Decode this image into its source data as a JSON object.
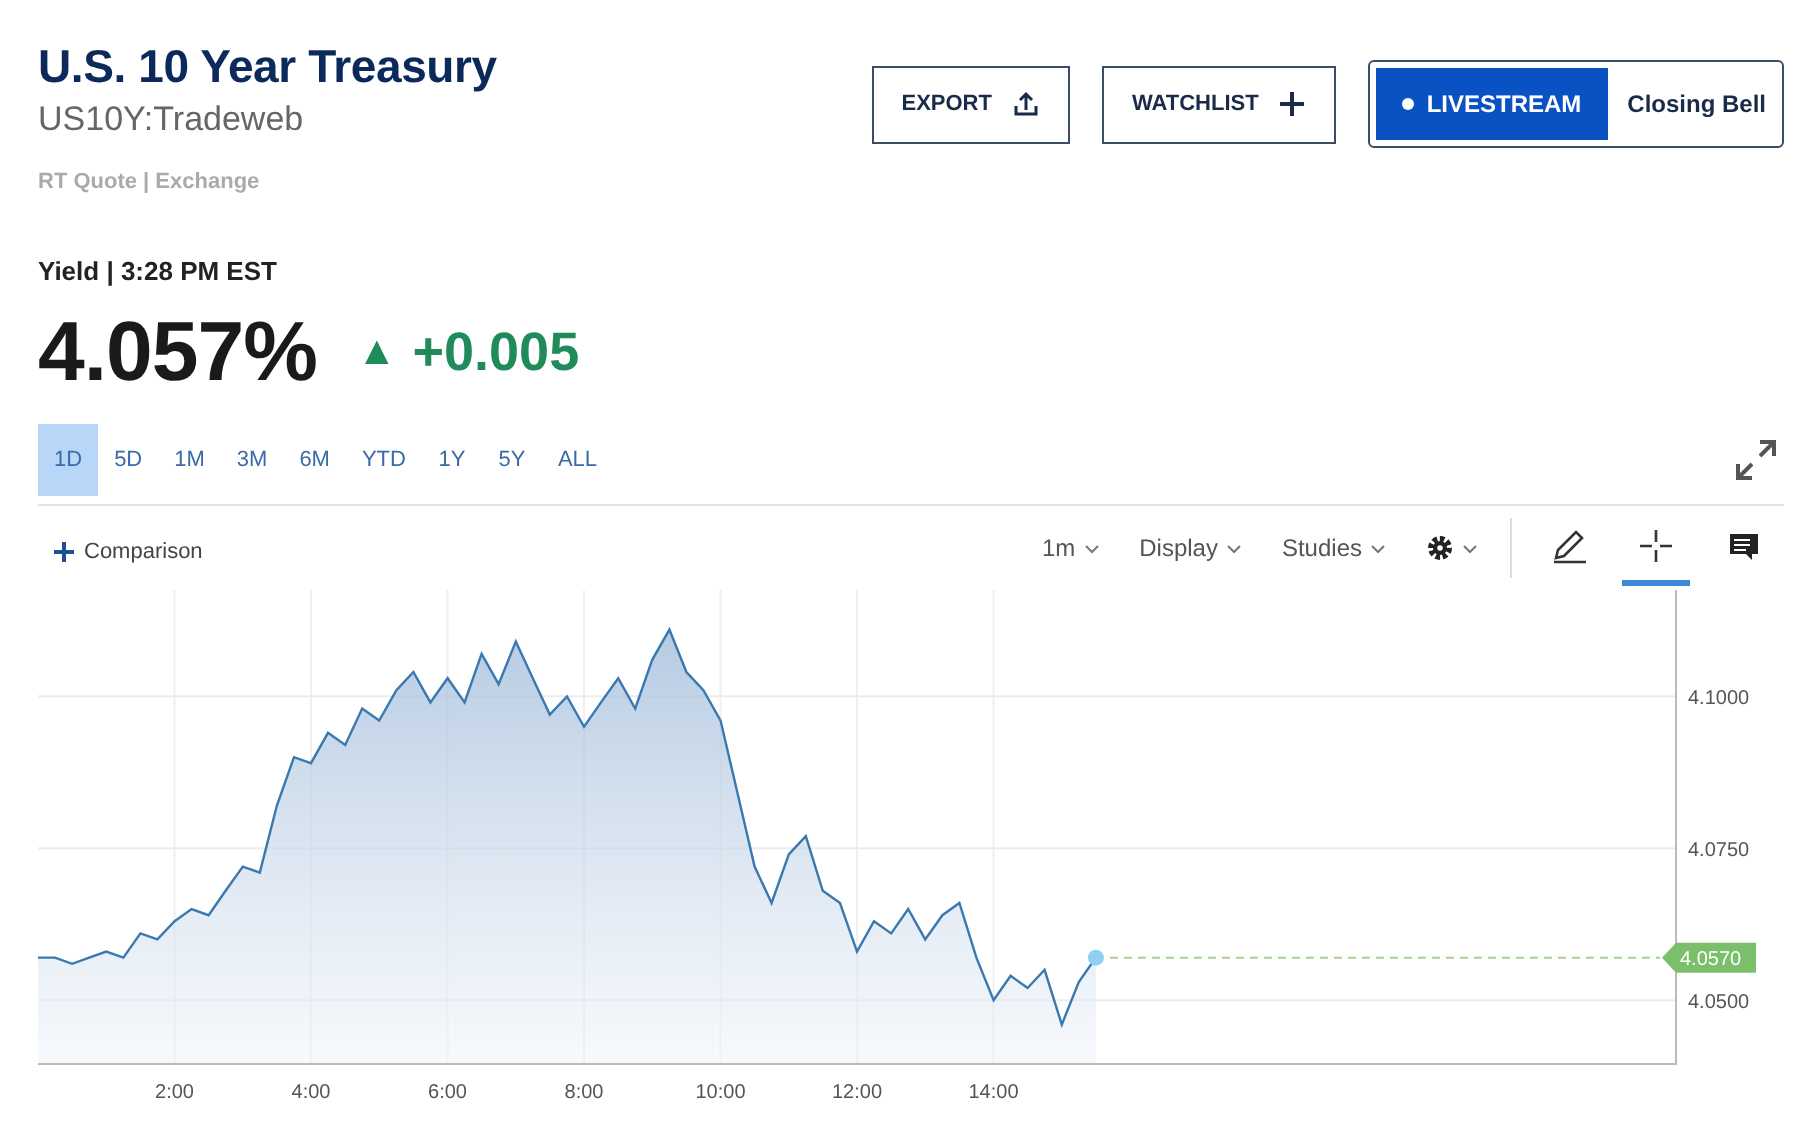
{
  "header": {
    "title": "U.S. 10 Year Treasury",
    "symbol": "US10Y:Tradeweb",
    "source": "RT Quote | Exchange"
  },
  "actions": [
    {
      "kind": "export",
      "label": "EXPORT"
    },
    {
      "kind": "watchlist",
      "label": "WATCHLIST"
    }
  ],
  "livestream": {
    "label": "LIVESTREAM",
    "show": "Closing Bell"
  },
  "quote": {
    "label": "Yield | 3:28 PM EST",
    "price": "4.057%",
    "change": "+0.005",
    "arrow": "▲"
  },
  "ranges": [
    {
      "label": "1D",
      "selected": true
    },
    {
      "label": "5D",
      "selected": false
    },
    {
      "label": "1M",
      "selected": false
    },
    {
      "label": "3M",
      "selected": false
    },
    {
      "label": "6M",
      "selected": false
    },
    {
      "label": "YTD",
      "selected": false
    },
    {
      "label": "1Y",
      "selected": false
    },
    {
      "label": "5Y",
      "selected": false
    },
    {
      "label": "ALL",
      "selected": false
    }
  ],
  "toolbar": {
    "comparison": "Comparison",
    "interval": "1m",
    "display": "Display",
    "studies": "Studies",
    "tools": [
      {
        "kind": "draw",
        "selected": false
      },
      {
        "kind": "crosshair",
        "selected": true
      },
      {
        "kind": "comment",
        "selected": false
      }
    ]
  },
  "chart": {
    "last_label": "4.0570",
    "chart_data": {
      "type": "line",
      "x": [
        0,
        0.25,
        0.5,
        0.75,
        1,
        1.25,
        1.5,
        1.75,
        2,
        2.25,
        2.5,
        2.75,
        3,
        3.25,
        3.5,
        3.75,
        4,
        4.25,
        4.5,
        4.75,
        5,
        5.25,
        5.5,
        5.75,
        6,
        6.25,
        6.5,
        6.75,
        7,
        7.25,
        7.5,
        7.75,
        8,
        8.25,
        8.5,
        8.75,
        9,
        9.25,
        9.5,
        9.75,
        10,
        10.25,
        10.5,
        10.75,
        11,
        11.25,
        11.5,
        11.75,
        12,
        12.25,
        12.5,
        12.75,
        13,
        13.25,
        13.5,
        13.75,
        14,
        14.25,
        14.5,
        14.75,
        15,
        15.25,
        15.5
      ],
      "grid": true,
      "series": [
        {
          "color": "#3a78b0",
          "values": [
            4.057,
            4.057,
            4.056,
            4.057,
            4.058,
            4.057,
            4.061,
            4.06,
            4.063,
            4.065,
            4.064,
            4.068,
            4.072,
            4.071,
            4.082,
            4.09,
            4.089,
            4.094,
            4.092,
            4.098,
            4.096,
            4.101,
            4.104,
            4.099,
            4.103,
            4.099,
            4.107,
            4.102,
            4.109,
            4.103,
            4.097,
            4.1,
            4.095,
            4.099,
            4.103,
            4.098,
            4.106,
            4.111,
            4.104,
            4.101,
            4.096,
            4.084,
            4.072,
            4.066,
            4.074,
            4.077,
            4.068,
            4.066,
            4.058,
            4.063,
            4.061,
            4.065,
            4.06,
            4.064,
            4.066,
            4.057,
            4.05,
            4.054,
            4.052,
            4.055,
            4.046,
            4.053,
            4.057
          ]
        }
      ],
      "xlim": [
        0,
        24
      ],
      "ylim": [
        4.0395,
        4.1175
      ],
      "xticks": [
        {
          "value": 2,
          "label": "2:00"
        },
        {
          "value": 4,
          "label": "4:00"
        },
        {
          "value": 6,
          "label": "6:00"
        },
        {
          "value": 8,
          "label": "8:00"
        },
        {
          "value": 10,
          "label": "10:00"
        },
        {
          "value": 12,
          "label": "12:00"
        },
        {
          "value": 14,
          "label": "14:00"
        }
      ],
      "yticks": [
        {
          "value": 4.05,
          "label": "4.0500"
        },
        {
          "value": 4.075,
          "label": "4.0750"
        },
        {
          "value": 4.1,
          "label": "4.1000"
        }
      ]
    }
  }
}
